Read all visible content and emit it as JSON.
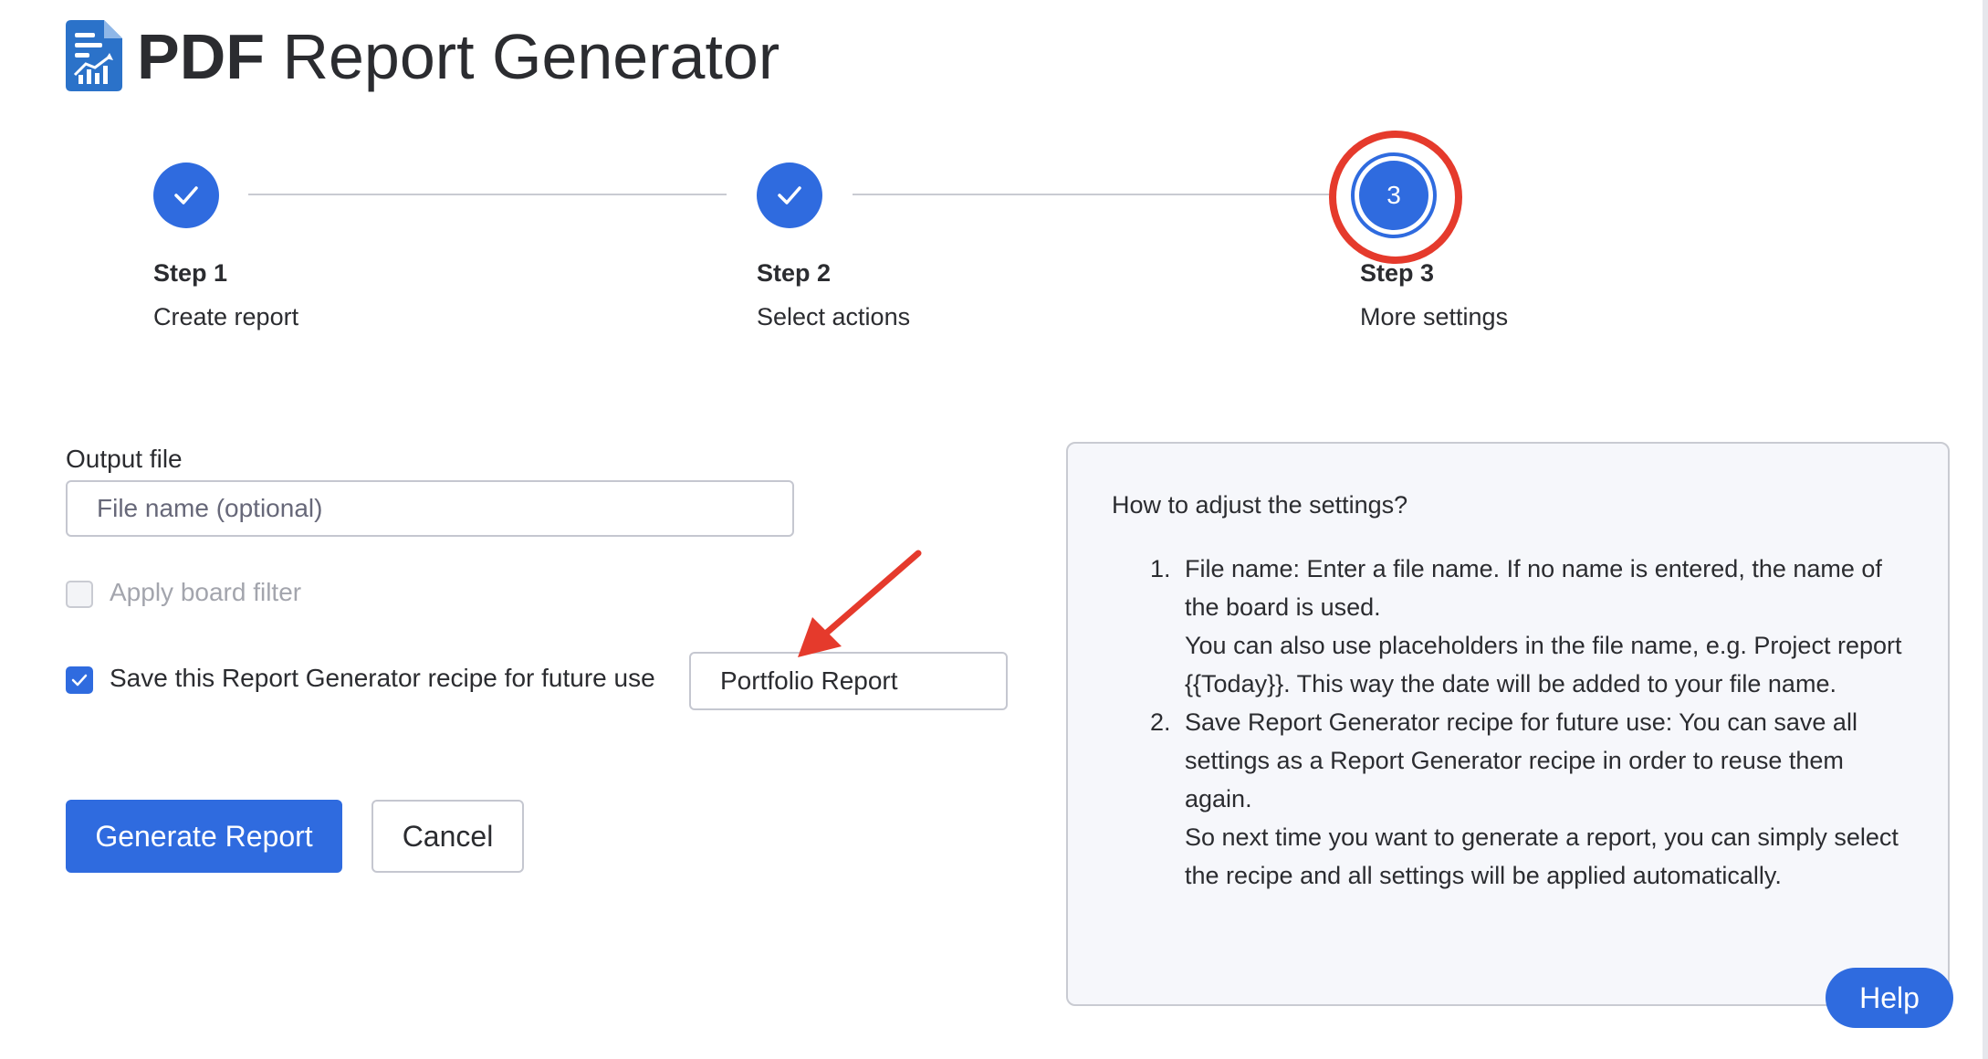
{
  "app": {
    "title_bold": "PDF",
    "title_rest": " Report Generator"
  },
  "stepper": {
    "steps": [
      {
        "label": "Step 1",
        "description": "Create report",
        "state": "completed"
      },
      {
        "label": "Step 2",
        "description": "Select actions",
        "state": "completed"
      },
      {
        "label": "Step 3",
        "description": "More settings",
        "state": "current",
        "number": "3"
      }
    ]
  },
  "form": {
    "output_file_label": "Output file",
    "file_name": {
      "value": "",
      "placeholder": "File name (optional)"
    },
    "apply_board_filter": {
      "label": "Apply board filter",
      "checked": false,
      "disabled": true
    },
    "save_recipe": {
      "label": "Save this Report Generator recipe for future use",
      "checked": true
    },
    "recipe_name": {
      "value": "Portfolio Report"
    },
    "generate_label": "Generate Report",
    "cancel_label": "Cancel"
  },
  "info": {
    "title": "How to adjust the settings?",
    "items": [
      {
        "number": "1.",
        "paragraphs": [
          "File name: Enter a file name. If no name is entered, the name of the board is used.",
          "You can also use placeholders in the file name, e.g. Project report {{Today}}. This way the date will be added to your file name."
        ]
      },
      {
        "number": "2.",
        "paragraphs": [
          "Save Report Generator recipe for future use: You can save all settings as a Report Generator recipe in order to reuse them again.",
          "So next time you want to generate a report, you can simply select the recipe and all settings will be applied automatically."
        ]
      }
    ]
  },
  "help_label": "Help",
  "colors": {
    "primary": "#2f6bdf",
    "annotation": "#e53a2c",
    "panel_bg": "#f6f7fb"
  },
  "icons": {
    "logo": "pdf-report-logo-icon",
    "completed_step": "check-icon",
    "checkbox_checked": "check-icon",
    "annotation_arrow": "arrow-icon"
  }
}
